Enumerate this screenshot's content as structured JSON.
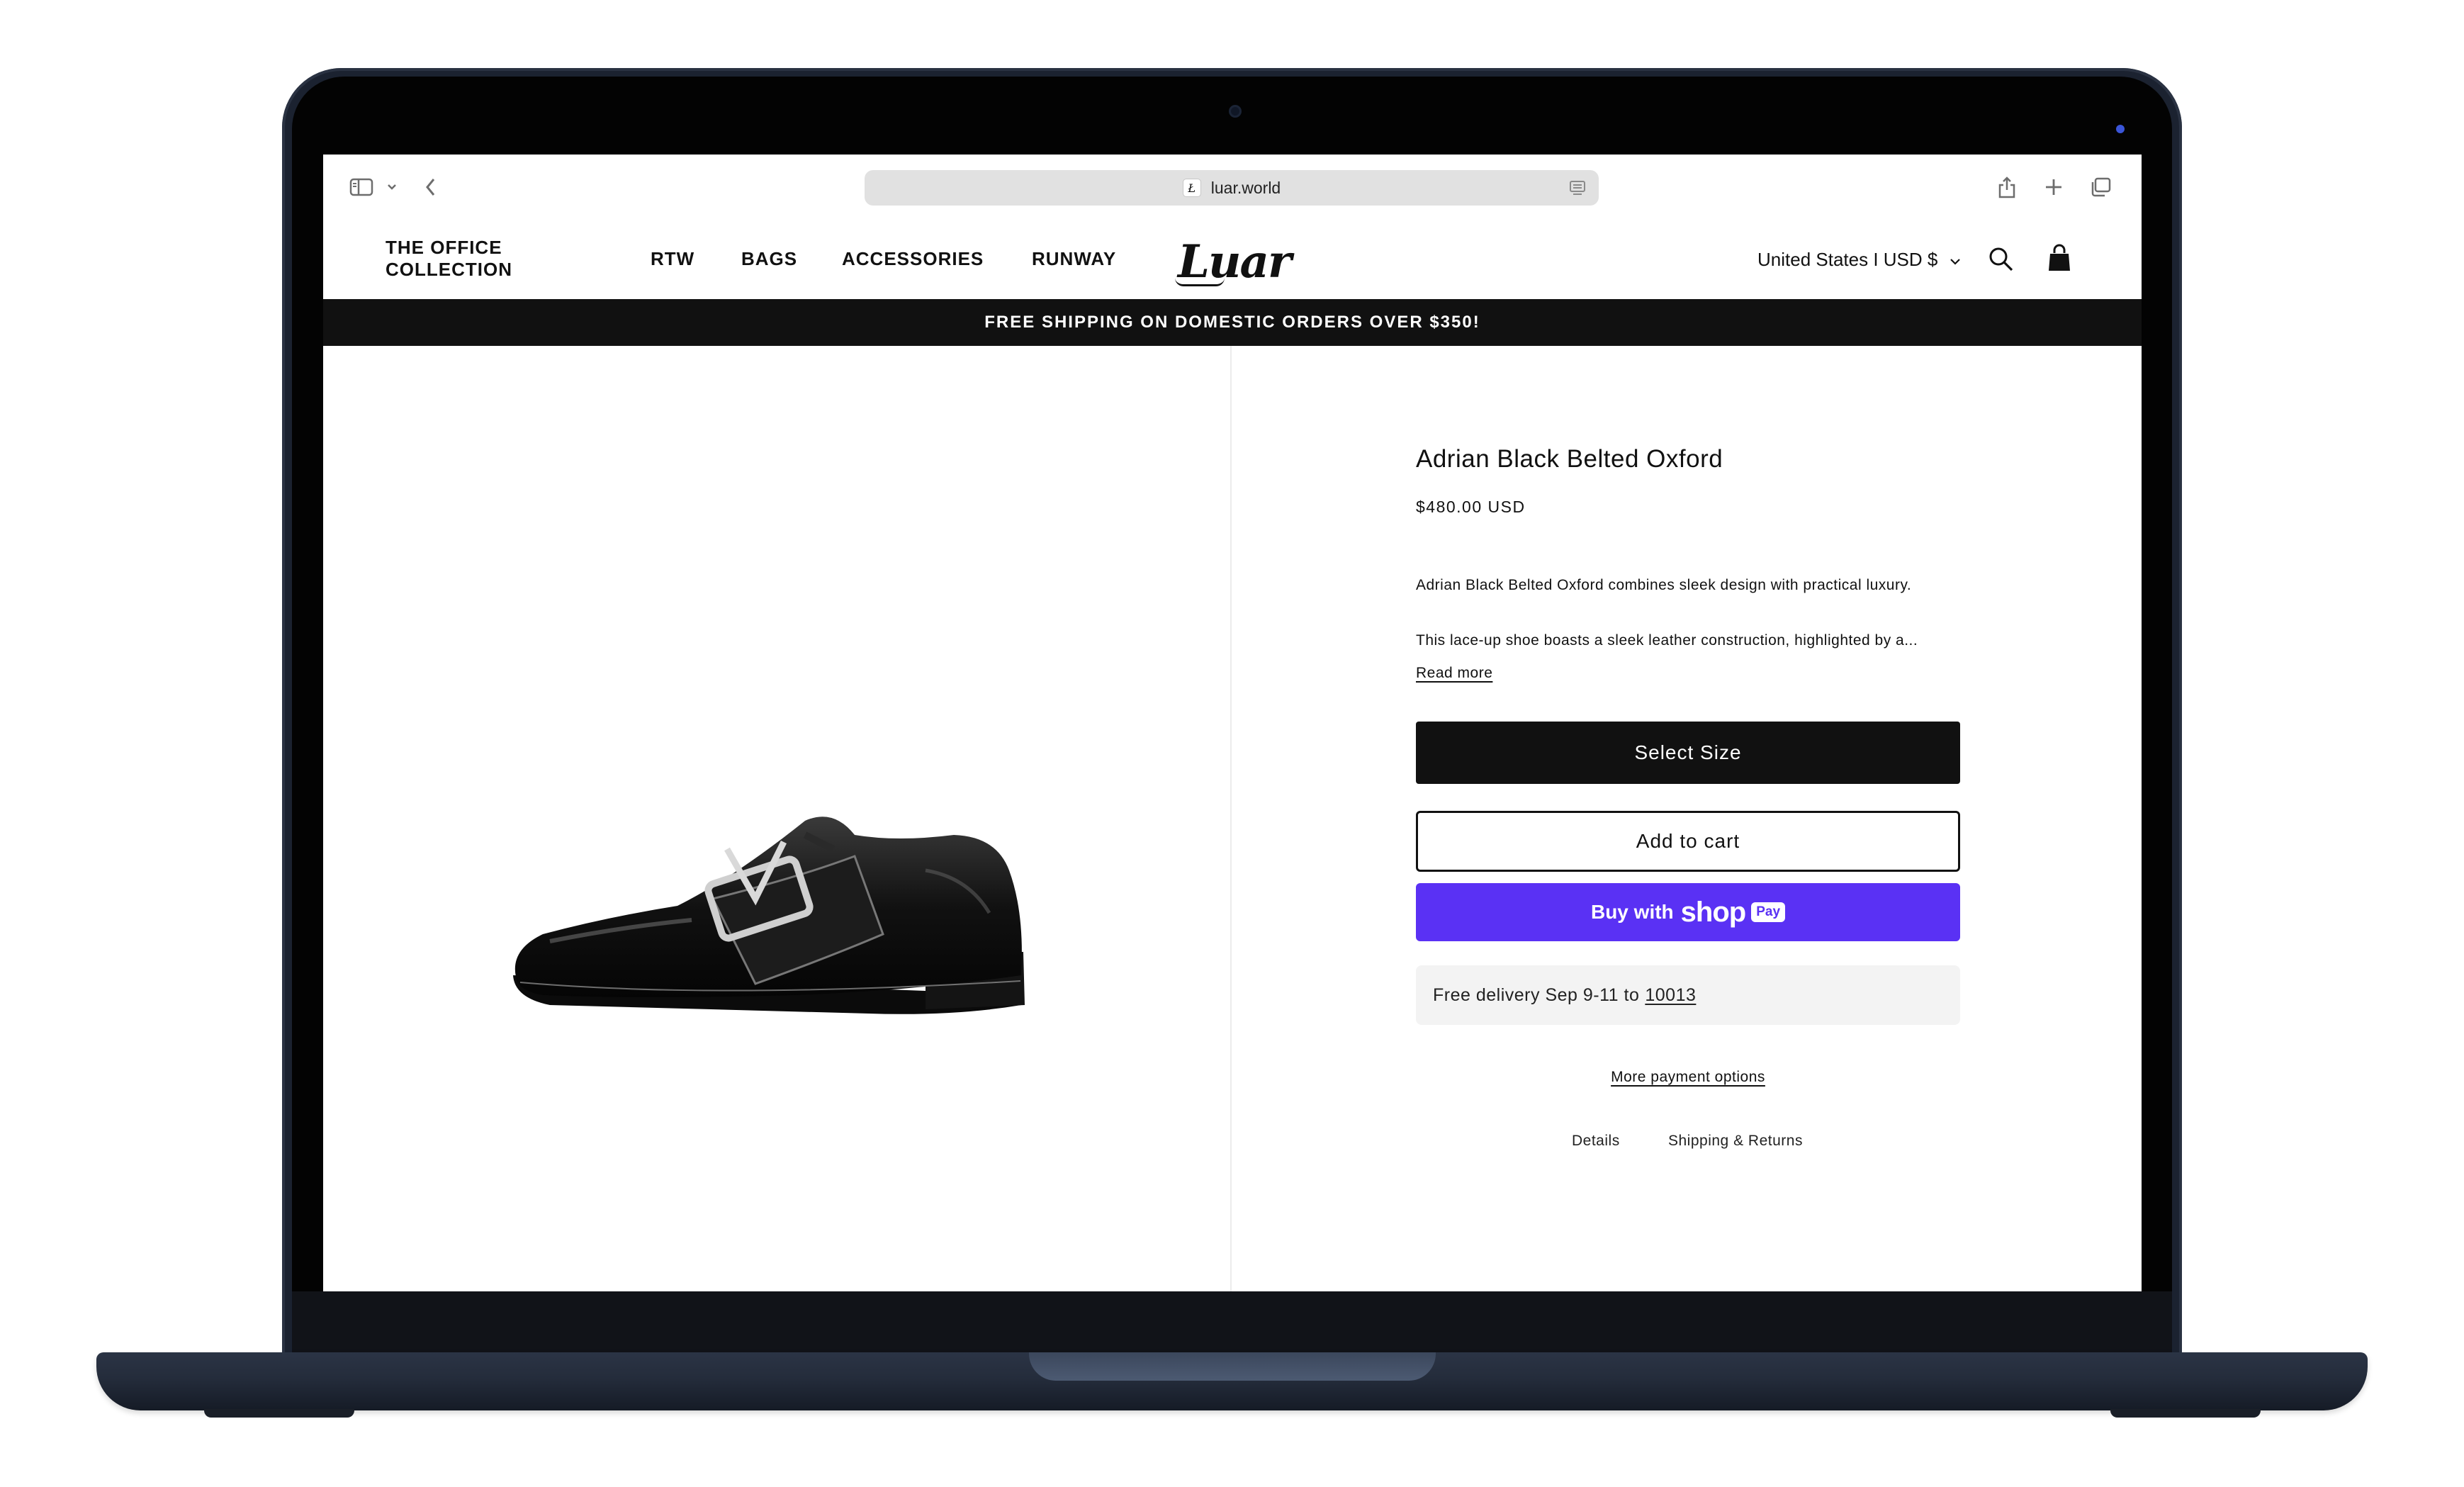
{
  "browser": {
    "url": "luar.world",
    "favicon_letter": "Ł",
    "icons": [
      "sidebar-icon",
      "chevron-down-icon",
      "back-icon",
      "reader-icon",
      "share-icon",
      "plus-icon",
      "tabs-icon"
    ]
  },
  "header": {
    "nav": [
      "THE OFFICE COLLECTION",
      "RTW",
      "BAGS",
      "ACCESSORIES",
      "RUNWAY"
    ],
    "logo": "Luar",
    "locale": "United States I USD $",
    "icons": [
      "search-icon",
      "bag-icon"
    ]
  },
  "announcement": "FREE SHIPPING ON DOMESTIC ORDERS OVER $350!",
  "product": {
    "title": "Adrian Black Belted Oxford",
    "price": "$480.00 USD",
    "description_1": "Adrian Black Belted Oxford combines sleek design with practical luxury.",
    "description_2": "This lace-up shoe boasts a sleek leather construction, highlighted by a...",
    "read_more": "Read more",
    "select_size": "Select Size",
    "add_to_cart": "Add to cart",
    "buy_with": "Buy with",
    "shop": "shop",
    "pay": "Pay",
    "delivery_text": "Free delivery Sep 9-11 to",
    "delivery_zip": "10013",
    "more_payment": "More payment options",
    "tabs": [
      "Details",
      "Shipping & Returns"
    ]
  },
  "colors": {
    "brand_black": "#111111",
    "shop_pay_purple": "#5a31f4",
    "laptop_midnight": "#1b2230"
  }
}
